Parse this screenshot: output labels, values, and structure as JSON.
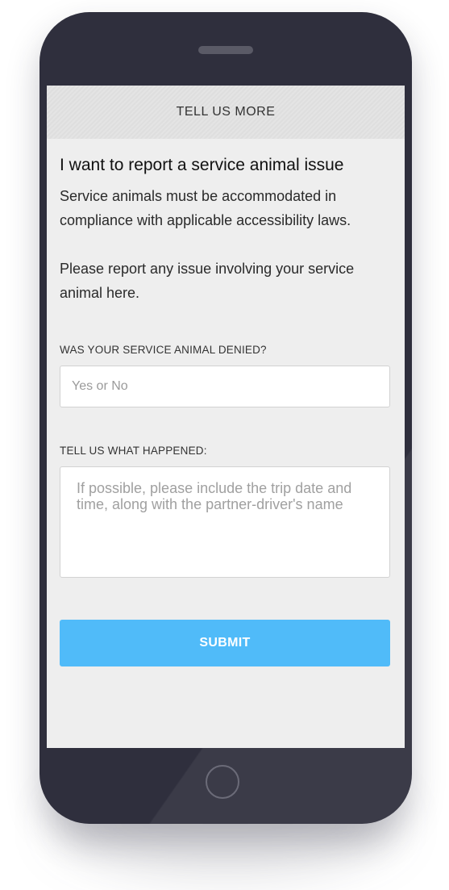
{
  "screen": {
    "header_title": "TELL US MORE"
  },
  "form": {
    "heading": "I want to report a service animal issue",
    "paragraph_1": "Service animals must be accommodated in compliance with applicable accessibility laws.",
    "paragraph_2": "Please report any issue involving your service animal here.",
    "denied_field": {
      "label": "WAS YOUR SERVICE ANIMAL DENIED?",
      "value": "",
      "placeholder": "Yes or No"
    },
    "details_field": {
      "label": "TELL US WHAT HAPPENED:",
      "value": "",
      "placeholder": "If possible, please include the trip date and time, along with the partner-driver's name"
    },
    "submit_label": "SUBMIT"
  },
  "colors": {
    "accent": "#50bbf9",
    "phone_body": "#2f2f3d",
    "screen_background": "#eeeeee"
  },
  "icons": {
    "home_button": "home-button-icon",
    "speaker": "speaker-grille-icon"
  }
}
